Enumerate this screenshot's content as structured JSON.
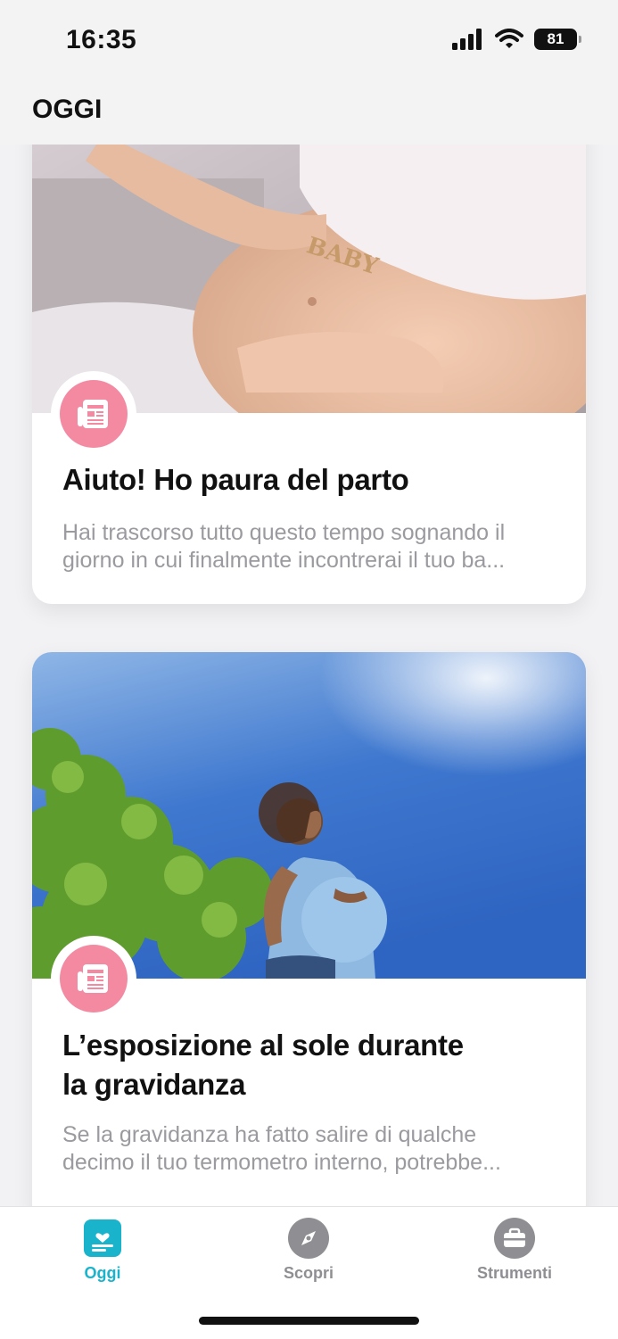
{
  "status_bar": {
    "time": "16:35",
    "battery": "81"
  },
  "header": {
    "title": "OGGI"
  },
  "feed": {
    "cards": [
      {
        "image": "pregnant-belly-baby-letters",
        "icon": "article-icon",
        "title": "Aiuto! Ho paura del parto",
        "excerpt": "Hai trascorso tutto questo tempo sognando il giorno in cui finalmente incontrerai il tuo ba..."
      },
      {
        "image": "pregnant-woman-sun-tree",
        "icon": "article-icon",
        "title_line1": "L’esposizione al sole durante",
        "title_line2": "la gravidanza",
        "excerpt": "Se la gravidanza ha fatto salire di qualche decimo il tuo termometro interno, potrebbe..."
      }
    ]
  },
  "tab_bar": {
    "tabs": [
      {
        "label": "Oggi",
        "icon": "today-icon",
        "active": true
      },
      {
        "label": "Scopri",
        "icon": "compass-icon",
        "active": false
      },
      {
        "label": "Strumenti",
        "icon": "toolbox-icon",
        "active": false
      }
    ]
  },
  "colors": {
    "accent": "#19b3cc",
    "badge": "#f38aa1",
    "inactive": "#8e8e93"
  }
}
